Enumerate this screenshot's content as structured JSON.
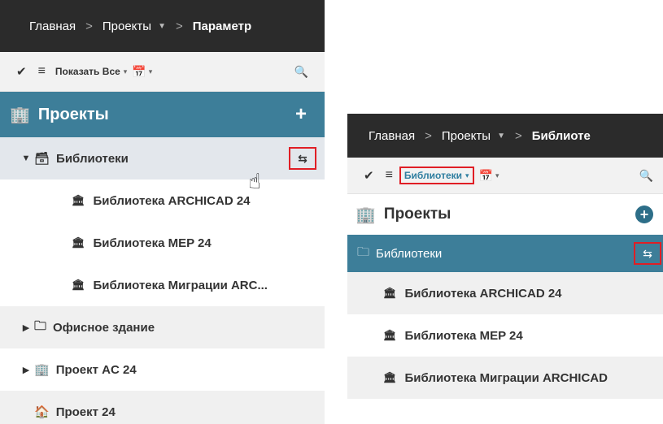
{
  "left": {
    "breadcrumb": {
      "home": "Главная",
      "sep1": ">",
      "projects": "Проекты",
      "caret": "▼",
      "sep2": ">",
      "current": "Параметр"
    },
    "toolbar": {
      "check": "✔",
      "lines": "≡",
      "filter": "Показать Все",
      "filter_caret": "▾",
      "calendar": "📅",
      "cal_caret": "▾",
      "search": "🔍"
    },
    "header": {
      "icon": "🏢",
      "title": "Проекты",
      "plus": "+"
    },
    "tree": {
      "libraries": "Библиотеки",
      "lib1": "Библиотека ARCHICAD 24",
      "lib2": "Библиотека MEP 24",
      "lib3": "Библиотека Миграции ARC...",
      "office": "Офисное здание",
      "proj_ac": "Проект AC 24",
      "proj24": "Проект 24"
    }
  },
  "right": {
    "breadcrumb": {
      "home": "Главная",
      "sep1": ">",
      "projects": "Проекты",
      "caret": "▼",
      "sep2": ">",
      "current": "Библиоте"
    },
    "toolbar": {
      "check": "✔",
      "lines": "≡",
      "filter": "Библиотеки",
      "filter_caret": "▾",
      "calendar": "📅",
      "cal_caret": "▾",
      "search": "🔍"
    },
    "header": {
      "icon": "🏢",
      "title": "Проекты",
      "plus": "+"
    },
    "tree": {
      "libraries": "Библиотеки",
      "lib1": "Библиотека ARCHICAD 24",
      "lib2": "Библиотека MEP 24",
      "lib3": "Библиотека Миграции ARCHICAD"
    }
  },
  "colors": {
    "accent": "#3d7e99",
    "highlight": "#e01e25",
    "dark_bar": "#2b2b2b"
  }
}
